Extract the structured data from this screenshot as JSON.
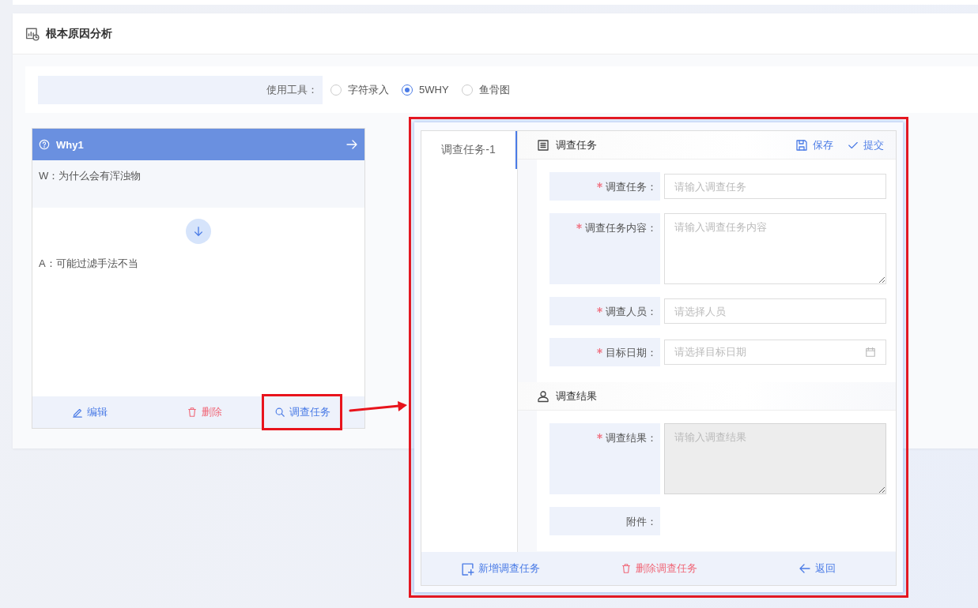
{
  "page": {
    "title": "根本原因分析"
  },
  "tool_select": {
    "label": "使用工具：",
    "options": [
      {
        "label": "字符录入",
        "selected": false
      },
      {
        "label": "5WHY",
        "selected": true
      },
      {
        "label": "鱼骨图",
        "selected": false
      }
    ]
  },
  "why_cards": [
    {
      "title": "Why1",
      "question": "W：为什么会有浑浊物",
      "answer": "A：可能过滤手法不当",
      "actions": [
        {
          "kind": "edit",
          "label": "编辑",
          "highlighted": false
        },
        {
          "kind": "delete",
          "label": "删除",
          "highlighted": false
        },
        {
          "kind": "search",
          "label": "调查任务",
          "highlighted": true
        }
      ]
    }
  ],
  "task_panel": {
    "tabs": [
      {
        "label": "调查任务-1",
        "selected": true
      }
    ],
    "sections": [
      {
        "kind": "task",
        "title": "调查任务",
        "actions": [
          {
            "kind": "save",
            "label": "保存"
          },
          {
            "kind": "submit",
            "label": "提交"
          }
        ],
        "fields": [
          {
            "kind": "input",
            "label": "调查任务：",
            "required": true,
            "placeholder": "请输入调查任务",
            "disabled": false
          },
          {
            "kind": "textarea",
            "label": "调查任务内容：",
            "required": true,
            "placeholder": "请输入调查任务内容",
            "disabled": false
          },
          {
            "kind": "input",
            "label": "调查人员：",
            "required": true,
            "placeholder": "请选择人员",
            "disabled": false
          },
          {
            "kind": "date",
            "label": "目标日期：",
            "required": true,
            "placeholder": "请选择目标日期",
            "disabled": false
          }
        ]
      },
      {
        "kind": "result",
        "title": "调查结果",
        "fields": [
          {
            "kind": "textarea",
            "label": "调查结果：",
            "required": true,
            "placeholder": "请输入调查结果",
            "disabled": true
          },
          {
            "kind": "attachment",
            "label": "附件：",
            "required": false
          }
        ]
      }
    ],
    "footer": [
      {
        "kind": "add",
        "label": "新增调查任务"
      },
      {
        "kind": "delete",
        "label": "删除调查任务"
      },
      {
        "kind": "back",
        "label": "返回"
      }
    ]
  }
}
